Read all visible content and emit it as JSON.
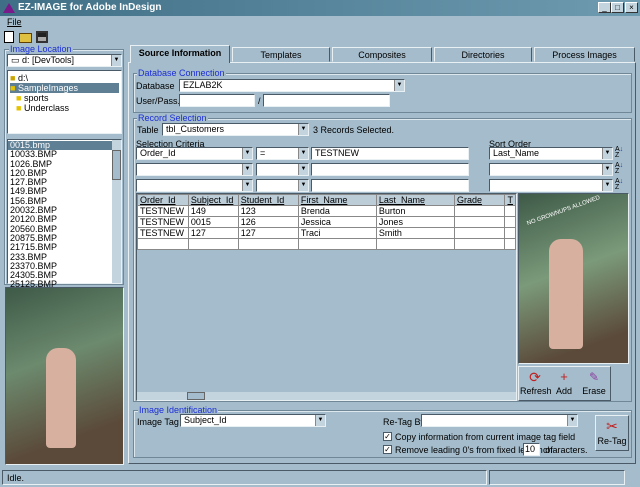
{
  "window": {
    "title": "EZ-IMAGE for Adobe InDesign",
    "menu": [
      "File"
    ]
  },
  "toolbar": {
    "icons": [
      "new-icon",
      "open-icon",
      "save-icon"
    ]
  },
  "left": {
    "image_location_label": "Image Location",
    "drive": "d: [DevTools]",
    "folders": [
      "d:\\",
      "SampleImages",
      "sports",
      "Underclass"
    ],
    "selected_folder": "SampleImages",
    "files": [
      "0015.bmp",
      "10033.BMP",
      "1026.BMP",
      "120.BMP",
      "127.BMP",
      "149.BMP",
      "156.BMP",
      "20032.BMP",
      "20120.BMP",
      "20560.BMP",
      "20875.BMP",
      "21715.BMP",
      "233.BMP",
      "23370.BMP",
      "24305.BMP",
      "25125.BMP"
    ]
  },
  "tabs": [
    "Source Information",
    "Templates",
    "Composites",
    "Directories",
    "Process Images"
  ],
  "db": {
    "group_label": "Database Connection",
    "database_label": "Database",
    "database": "EZLAB2K",
    "userpass_label": "User/Pass.",
    "user": "",
    "pass": "",
    "separator": "/"
  },
  "records": {
    "group_label": "Record Selection",
    "table_label": "Table",
    "table": "tbl_Customers",
    "status": "3 Records Selected.",
    "criteria_label": "Selection Criteria",
    "sort_label": "Sort Order",
    "criteria": [
      {
        "field": "Order_Id",
        "op": "=",
        "value": "TESTNEW",
        "sort": "Last_Name"
      },
      {
        "field": "",
        "op": "",
        "value": "",
        "sort": ""
      },
      {
        "field": "",
        "op": "",
        "value": "",
        "sort": ""
      }
    ],
    "columns": [
      "Order_Id",
      "Subject_Id",
      "Student_Id",
      "First_Name",
      "Last_Name",
      "Grade",
      "T"
    ],
    "rows": [
      [
        "TESTNEW",
        "149",
        "123",
        "Brenda",
        "Burton",
        ""
      ],
      [
        "TESTNEW",
        "0015",
        "126",
        "Jessica",
        "Jones",
        ""
      ],
      [
        "TESTNEW",
        "127",
        "127",
        "Traci",
        "Smith",
        ""
      ]
    ],
    "buttons": {
      "refresh": "Refresh",
      "add": "Add",
      "erase": "Erase"
    }
  },
  "ident": {
    "group_label": "Image Identification",
    "tag_label": "Image Tag",
    "tag": "Subject_Id",
    "retag_by_label": "Re-Tag By",
    "retag_by": "",
    "copy_label": "Copy information from current image tag field",
    "copy_checked": true,
    "remove_label": "Remove leading 0's from fixed length of",
    "remove_checked": true,
    "length": "10",
    "chars_label": "characters.",
    "retag_button": "Re-Tag"
  },
  "photo_text": "NO GROWNUPS ALLOWED",
  "status": "Idle."
}
